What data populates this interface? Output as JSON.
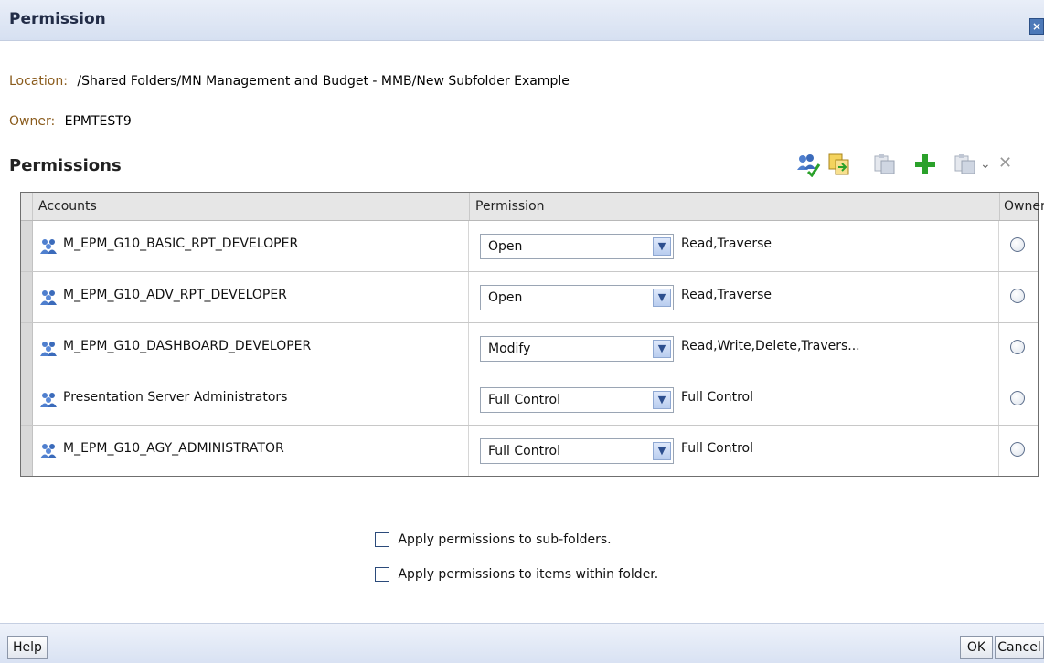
{
  "dialog": {
    "title": "Permission",
    "close_glyph": "×"
  },
  "location": {
    "label": "Location:",
    "value": "/Shared Folders/MN Management and Budget - MMB/New Subfolder Example"
  },
  "owner": {
    "label": "Owner:",
    "value": "EPMTEST9"
  },
  "section_title": "Permissions",
  "toolbar": {
    "icons": [
      "users-search-icon",
      "copy-permissions-icon",
      "paste-icon",
      "add-icon",
      "paste-menu-icon",
      "chevron-down-icon",
      "delete-icon"
    ],
    "dropdown_glyph": "⌄",
    "delete_glyph": "✕"
  },
  "table": {
    "headers": {
      "accounts": "Accounts",
      "permission": "Permission",
      "owner": "Owner"
    },
    "rows": [
      {
        "account": "M_EPM_G10_BASIC_RPT_DEVELOPER",
        "permission": "Open",
        "description": "Read,Traverse"
      },
      {
        "account": "M_EPM_G10_ADV_RPT_DEVELOPER",
        "permission": "Open",
        "description": "Read,Traverse"
      },
      {
        "account": "M_EPM_G10_DASHBOARD_DEVELOPER",
        "permission": "Modify",
        "description": "Read,Write,Delete,Travers..."
      },
      {
        "account": "Presentation Server Administrators",
        "permission": "Full Control",
        "description": "Full Control"
      },
      {
        "account": "M_EPM_G10_AGY_ADMINISTRATOR",
        "permission": "Full Control",
        "description": "Full Control"
      }
    ]
  },
  "options": {
    "subfolders": "Apply permissions to sub-folders.",
    "items": "Apply permissions to items within folder."
  },
  "buttons": {
    "help": "Help",
    "ok": "OK",
    "cancel": "Cancel"
  },
  "colors": {
    "label_brown": "#8a5b1c",
    "titlebar": "#d6e0f1",
    "add_green": "#2aa12a"
  }
}
